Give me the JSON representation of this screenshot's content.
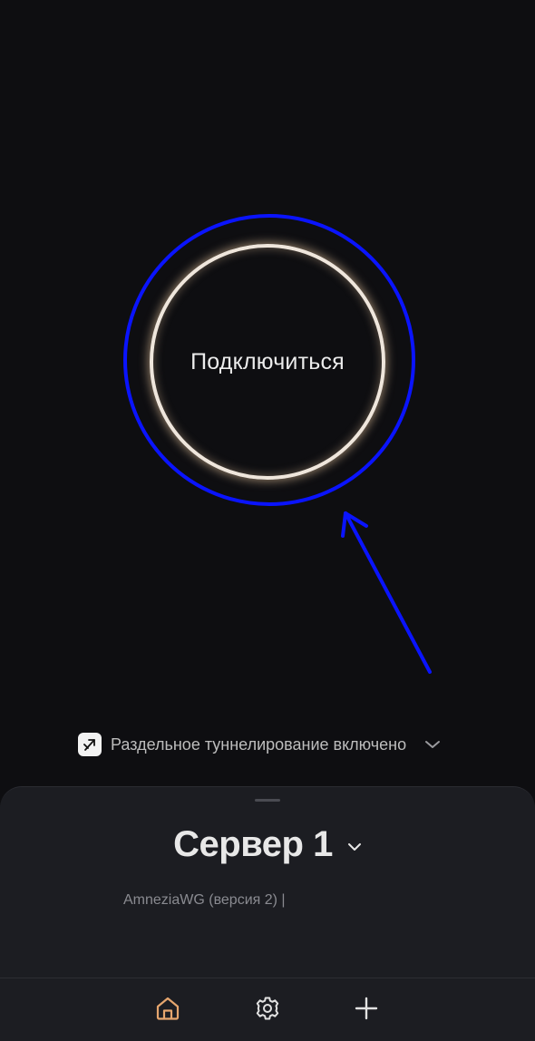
{
  "connect": {
    "label": "Подключиться"
  },
  "split_tunneling": {
    "label": "Раздельное туннелирование включено",
    "icon": "split-arrow-icon"
  },
  "server": {
    "name": "Сервер 1",
    "subtitle": "AmneziaWG (версия 2) |"
  },
  "nav": {
    "items": [
      {
        "id": "home",
        "icon": "home-icon",
        "active": true
      },
      {
        "id": "settings",
        "icon": "gear-icon",
        "active": false
      },
      {
        "id": "add",
        "icon": "plus-icon",
        "active": false
      }
    ]
  },
  "colors": {
    "background": "#0e0e11",
    "sheet": "#1c1d22",
    "ring": "#efe6dc",
    "ring_glow": "#ebc8a0",
    "accent_active": "#e6a66e",
    "annotation": "#0a14ff"
  }
}
